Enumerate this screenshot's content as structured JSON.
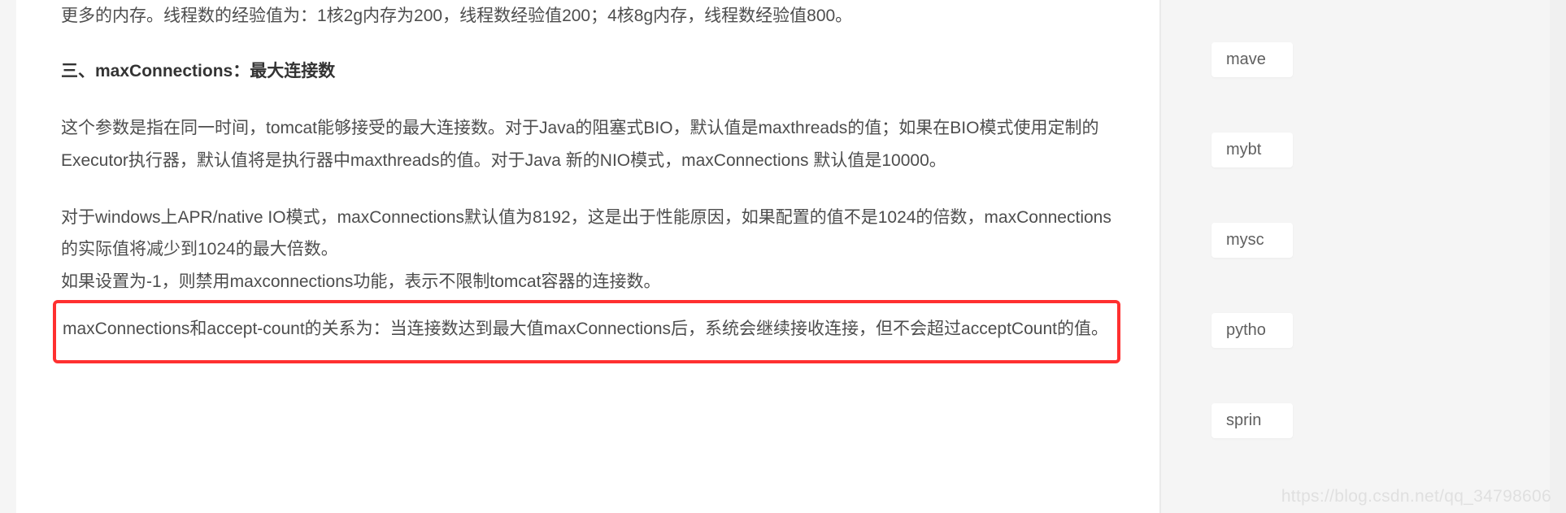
{
  "article": {
    "fragment_top": "更多的内存。线程数的经验值为：1核2g内存为200，线程数经验值200；4核8g内存，线程数经验值800。",
    "heading": "三、maxConnections：最大连接数",
    "para1": "这个参数是指在同一时间，tomcat能够接受的最大连接数。对于Java的阻塞式BIO，默认值是maxthreads的值；如果在BIO模式使用定制的Executor执行器，默认值将是执行器中maxthreads的值。对于Java 新的NIO模式，maxConnections 默认值是10000。",
    "para2_line1": "对于windows上APR/native IO模式，maxConnections默认值为8192，这是出于性能原因，如果配置的值不是1024的倍数，maxConnections 的实际值将减少到1024的最大倍数。",
    "para2_line2": "如果设置为-1，则禁用maxconnections功能，表示不限制tomcat容器的连接数。",
    "highlighted": "maxConnections和accept-count的关系为：当连接数达到最大值maxConnections后，系统会继续接收连接，但不会超过acceptCount的值。"
  },
  "sidebar": {
    "tags": [
      "mave",
      "mybt",
      "mysc",
      "pytho",
      "sprin"
    ]
  },
  "watermark": "https://blog.csdn.net/qq_34798606"
}
